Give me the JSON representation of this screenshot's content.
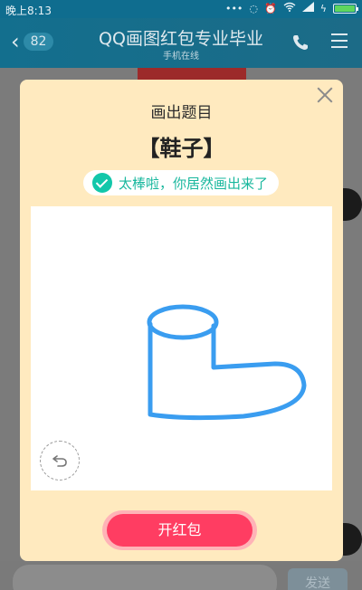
{
  "statusbar": {
    "time": "晚上8:13",
    "battery_level": 1.0
  },
  "titlebar": {
    "back_count": "82",
    "title": "QQ画图红包专业毕业",
    "subtitle": "手机在线",
    "icons": [
      "chevron-left-icon",
      "phone-icon",
      "menu-icon"
    ]
  },
  "modal": {
    "heading": "画出题目",
    "word": "【鞋子】",
    "result": "太棒啦，你居然画出来了",
    "open_label": "开红包"
  },
  "input": {
    "send_label": "发送"
  },
  "colors": {
    "accent": "#ff3d62",
    "success": "#12c7aa",
    "modal_bg": "#ffeabf",
    "header": "#136f8e",
    "stroke": "#3a9df0"
  }
}
